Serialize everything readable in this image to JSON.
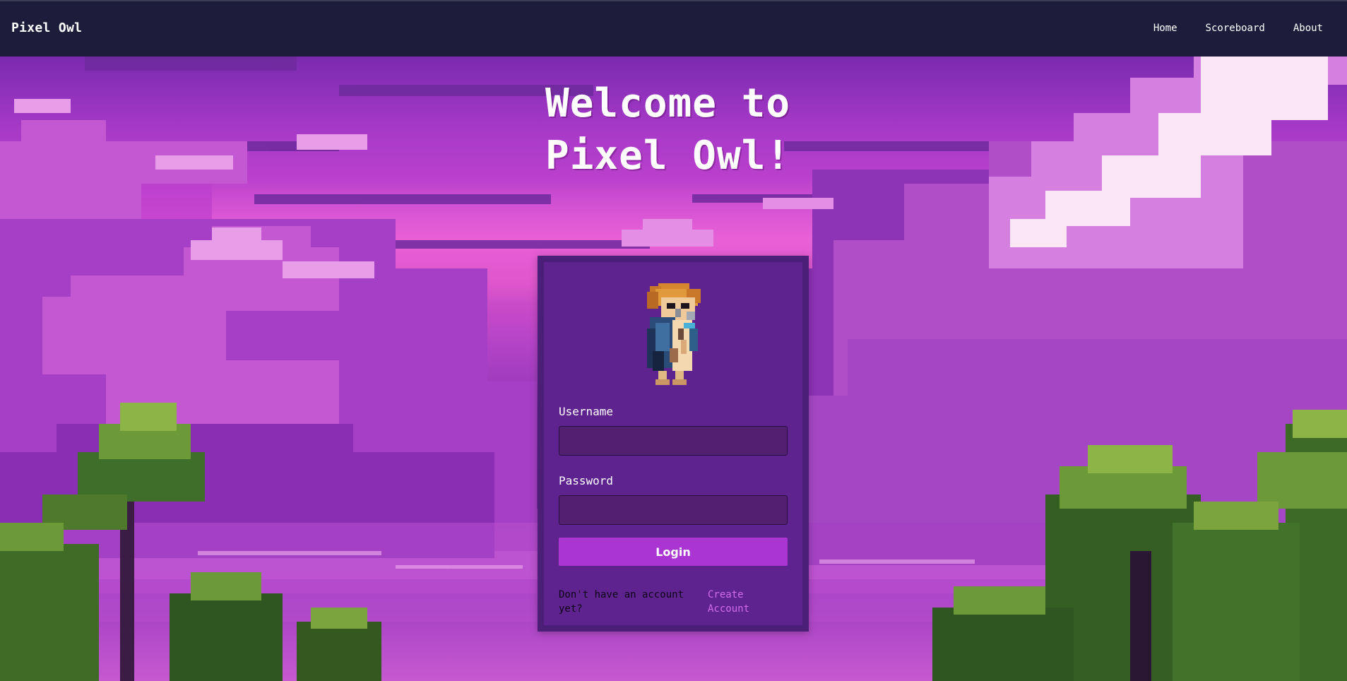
{
  "navbar": {
    "brand": "Pixel Owl",
    "links": [
      "Home",
      "Scoreboard",
      "About"
    ]
  },
  "hero": {
    "line1": "Welcome to",
    "line2": "Pixel Owl!"
  },
  "login": {
    "username_label": "Username",
    "username_value": "",
    "password_label": "Password",
    "password_value": "",
    "submit_label": "Login",
    "signup_prompt": "Don't have an account yet?",
    "signup_link": "Create Account"
  },
  "colors": {
    "navbar_bg": "#1d1d3b",
    "card_border": "#4b1e78",
    "card_bg": "#5f2390",
    "button_bg": "#aa35d3",
    "link": "#d06ce8"
  },
  "icons": {
    "mascot": "pixel-owl-icon"
  }
}
